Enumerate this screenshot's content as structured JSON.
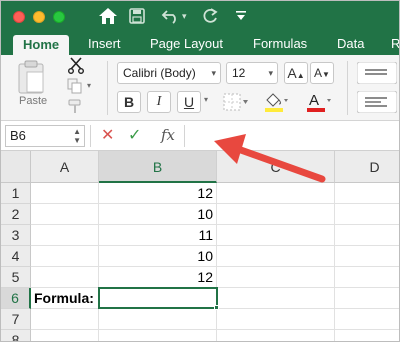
{
  "toolbar": {
    "tabs": [
      {
        "label": "Home",
        "active": true
      },
      {
        "label": "Insert"
      },
      {
        "label": "Page Layout"
      },
      {
        "label": "Formulas"
      },
      {
        "label": "Data"
      },
      {
        "label": "R"
      }
    ],
    "clipboard": {
      "paste_label": "Paste"
    },
    "font": {
      "family": "Calibri (Body)",
      "size": "12",
      "grow_label": "A",
      "shrink_label": "A",
      "bold_label": "B",
      "italic_label": "I",
      "underline_label": "U",
      "font_color_label": "A"
    }
  },
  "formula_bar": {
    "name_box": "B6",
    "fx_label": "fx",
    "formula": ""
  },
  "grid": {
    "columns": [
      "A",
      "B",
      "C",
      "D"
    ],
    "rows": [
      "1",
      "2",
      "3",
      "4",
      "5",
      "6",
      "7",
      "8"
    ],
    "cells": {
      "B1": "12",
      "B2": "10",
      "B3": "11",
      "B4": "10",
      "B5": "12",
      "A6": "Formula:"
    },
    "selected_cell": "B6"
  },
  "colors": {
    "accent": "#217346",
    "annotation_arrow": "#e8483f",
    "font_color_bar": "#e02020",
    "highlight_bar": "#ffeb3b"
  }
}
